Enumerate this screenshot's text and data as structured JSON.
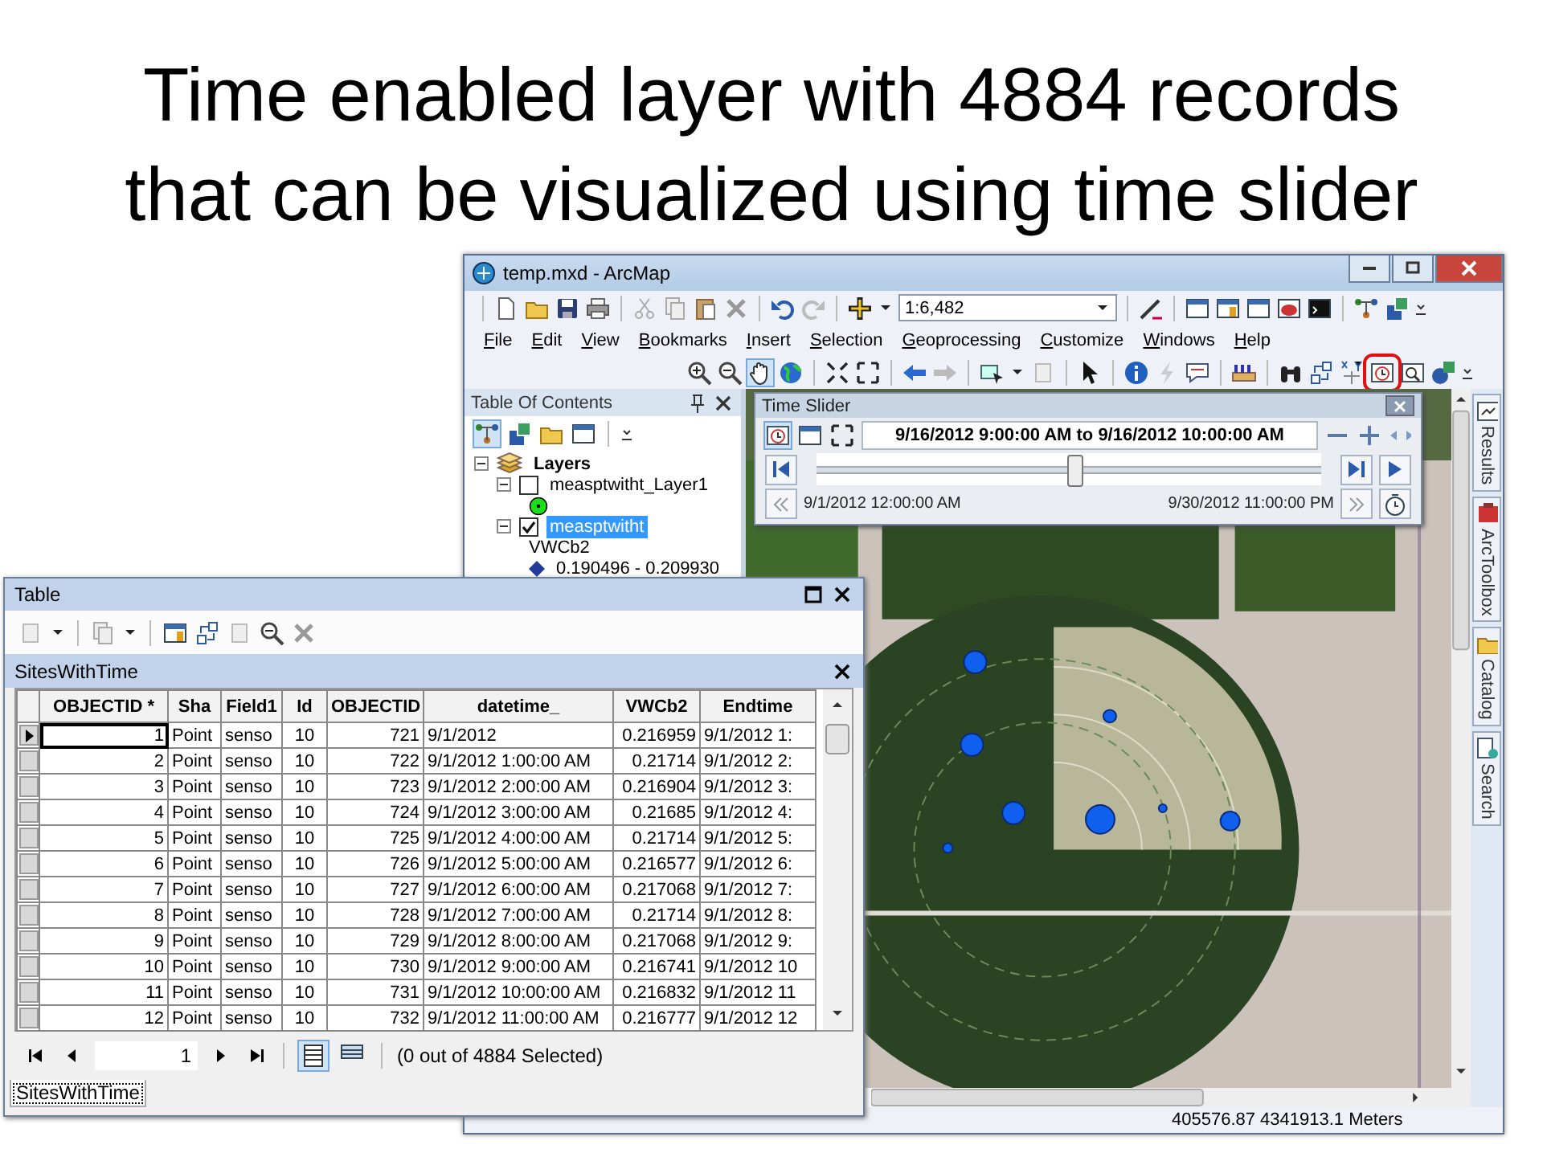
{
  "slide_title": "Time enabled layer with 4884 records that can be visualized using time slider",
  "arcmap": {
    "title": "temp.mxd - ArcMap",
    "scale": "1:6,482",
    "menu": [
      "File",
      "Edit",
      "View",
      "Bookmarks",
      "Insert",
      "Selection",
      "Geoprocessing",
      "Customize",
      "Windows",
      "Help"
    ],
    "time_slider_button": {
      "highlighted": true
    },
    "toc": {
      "title": "Table Of Contents",
      "tree": [
        {
          "kind": "group",
          "label": "Layers",
          "expanded": true,
          "children": [
            {
              "kind": "layer",
              "label": "measptwitht_Layer1",
              "checked": false,
              "selected": false,
              "expanded": true,
              "children": [
                {
                  "kind": "symbol",
                  "color": "#19e019"
                }
              ]
            },
            {
              "kind": "layer",
              "label": "measptwitht",
              "checked": true,
              "selected": true,
              "expanded": true,
              "children": [
                {
                  "kind": "heading",
                  "label": "VWCb2"
                },
                {
                  "kind": "class",
                  "label": "0.190496 - 0.209930",
                  "color": "#1f3a9a"
                }
              ]
            }
          ]
        }
      ]
    },
    "time_slider": {
      "title": "Time Slider",
      "range": "9/16/2012 9:00:00 AM to 9/16/2012 10:00:00 AM",
      "level": 0.51,
      "start": "9/1/2012 12:00:00 AM",
      "end": "9/30/2012 11:00:00 PM"
    },
    "dock_tabs": [
      "Results",
      "ArcToolbox",
      "Catalog",
      "Search"
    ],
    "status": "405576.87  4341913.1 Meters"
  },
  "table_window": {
    "title": "Table",
    "layer_title": "SitesWithTime",
    "columns": [
      {
        "label": "OBJECTID *",
        "kind": "number"
      },
      {
        "label": "Sha",
        "kind": "text"
      },
      {
        "label": "Field1",
        "kind": "text"
      },
      {
        "label": "Id",
        "kind": "short"
      },
      {
        "label": "OBJECTID",
        "kind": "number"
      },
      {
        "label": "datetime_",
        "kind": "text"
      },
      {
        "label": "VWCb2",
        "kind": "number"
      },
      {
        "label": "Endtime",
        "kind": "text"
      }
    ],
    "rows": [
      {
        "current": true,
        "cells": [
          "1",
          "Point",
          "senso",
          "10",
          "721",
          "9/1/2012",
          "0.216959",
          "9/1/2012 1:"
        ]
      },
      {
        "current": false,
        "cells": [
          "2",
          "Point",
          "senso",
          "10",
          "722",
          "9/1/2012 1:00:00 AM",
          "0.21714",
          "9/1/2012 2:"
        ]
      },
      {
        "current": false,
        "cells": [
          "3",
          "Point",
          "senso",
          "10",
          "723",
          "9/1/2012 2:00:00 AM",
          "0.216904",
          "9/1/2012 3:"
        ]
      },
      {
        "current": false,
        "cells": [
          "4",
          "Point",
          "senso",
          "10",
          "724",
          "9/1/2012 3:00:00 AM",
          "0.21685",
          "9/1/2012 4:"
        ]
      },
      {
        "current": false,
        "cells": [
          "5",
          "Point",
          "senso",
          "10",
          "725",
          "9/1/2012 4:00:00 AM",
          "0.21714",
          "9/1/2012 5:"
        ]
      },
      {
        "current": false,
        "cells": [
          "6",
          "Point",
          "senso",
          "10",
          "726",
          "9/1/2012 5:00:00 AM",
          "0.216577",
          "9/1/2012 6:"
        ]
      },
      {
        "current": false,
        "cells": [
          "7",
          "Point",
          "senso",
          "10",
          "727",
          "9/1/2012 6:00:00 AM",
          "0.217068",
          "9/1/2012 7:"
        ]
      },
      {
        "current": false,
        "cells": [
          "8",
          "Point",
          "senso",
          "10",
          "728",
          "9/1/2012 7:00:00 AM",
          "0.21714",
          "9/1/2012 8:"
        ]
      },
      {
        "current": false,
        "cells": [
          "9",
          "Point",
          "senso",
          "10",
          "729",
          "9/1/2012 8:00:00 AM",
          "0.217068",
          "9/1/2012 9:"
        ]
      },
      {
        "current": false,
        "cells": [
          "10",
          "Point",
          "senso",
          "10",
          "730",
          "9/1/2012 9:00:00 AM",
          "0.216741",
          "9/1/2012 10"
        ]
      },
      {
        "current": false,
        "cells": [
          "11",
          "Point",
          "senso",
          "10",
          "731",
          "9/1/2012 10:00:00 AM",
          "0.216832",
          "9/1/2012 11"
        ]
      },
      {
        "current": false,
        "cells": [
          "12",
          "Point",
          "senso",
          "10",
          "732",
          "9/1/2012 11:00:00 AM",
          "0.216777",
          "9/1/2012 12"
        ]
      }
    ],
    "current_record": "1",
    "selection": "(0 out of 4884 Selected)",
    "tabs": [
      {
        "label": "SitesWithTime",
        "selected": true
      }
    ]
  }
}
